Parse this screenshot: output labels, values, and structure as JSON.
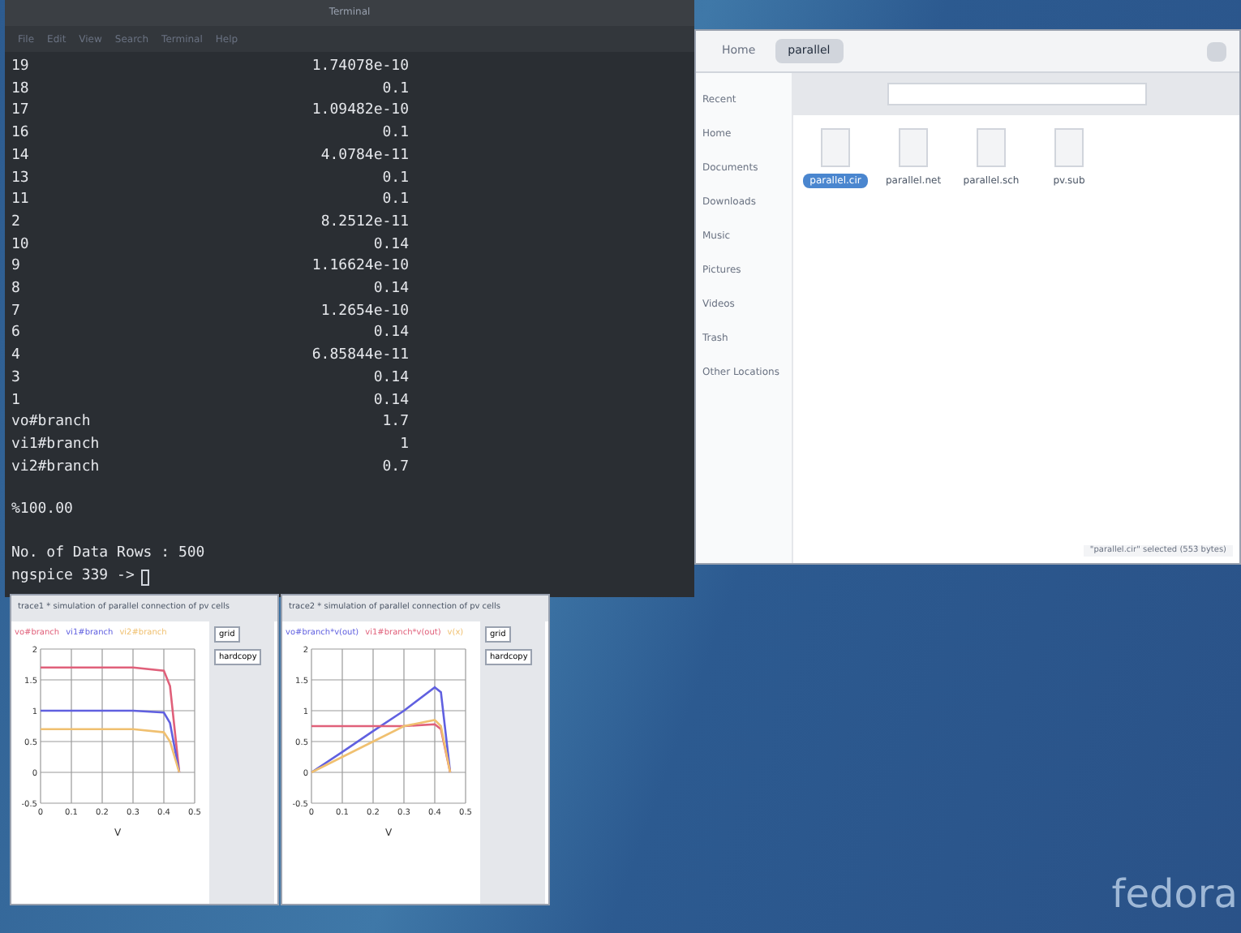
{
  "terminal": {
    "title": "Terminal",
    "menu": [
      "File",
      "Edit",
      "View",
      "Search",
      "Terminal",
      "Help"
    ],
    "rows": [
      {
        "name": "19",
        "value": "1.74078e-10"
      },
      {
        "name": "18",
        "value": "0.1"
      },
      {
        "name": "17",
        "value": "1.09482e-10"
      },
      {
        "name": "16",
        "value": "0.1"
      },
      {
        "name": "14",
        "value": "4.0784e-11"
      },
      {
        "name": "13",
        "value": "0.1"
      },
      {
        "name": "11",
        "value": "0.1"
      },
      {
        "name": "2",
        "value": "8.2512e-11"
      },
      {
        "name": "10",
        "value": "0.14"
      },
      {
        "name": "9",
        "value": "1.16624e-10"
      },
      {
        "name": "8",
        "value": "0.14"
      },
      {
        "name": "7",
        "value": "1.2654e-10"
      },
      {
        "name": "6",
        "value": "0.14"
      },
      {
        "name": "4",
        "value": "6.85844e-11"
      },
      {
        "name": "3",
        "value": "0.14"
      },
      {
        "name": "1",
        "value": "0.14"
      },
      {
        "name": "vo#branch",
        "value": "1.7"
      },
      {
        "name": "vi1#branch",
        "value": "1"
      },
      {
        "name": "vi2#branch",
        "value": "0.7"
      }
    ],
    "progress": "%100.00",
    "summary": "No. of Data Rows : 500",
    "prompt": "ngspice 339 ->"
  },
  "files": {
    "path": [
      {
        "label": "Home",
        "selected": false
      },
      {
        "label": "parallel",
        "selected": true
      }
    ],
    "sidebar": [
      "Recent",
      "Home",
      "Documents",
      "Downloads",
      "Music",
      "Pictures",
      "Videos",
      "Trash",
      "Other Locations"
    ],
    "items": [
      {
        "name": "parallel.cir",
        "selected": true
      },
      {
        "name": "parallel.net",
        "selected": false
      },
      {
        "name": "parallel.sch",
        "selected": false
      },
      {
        "name": "pv.sub",
        "selected": false
      }
    ],
    "status": "\"parallel.cir\" selected (553 bytes)"
  },
  "plots": [
    {
      "title": "trace1 * simulation of parallel connection of pv cells",
      "buttons": [
        "grid",
        "hardcopy"
      ],
      "chart_data": {
        "type": "line",
        "grid": true,
        "xlabel": "V",
        "x": [
          0,
          0.1,
          0.2,
          0.3,
          0.4,
          0.42,
          0.45
        ],
        "xlim": [
          0,
          0.5
        ],
        "ylim": [
          -0.5,
          2
        ],
        "xticks": [
          0,
          0.1,
          0.2,
          0.3,
          0.4,
          0.5
        ],
        "yticks": [
          -0.5,
          0,
          0.5,
          1,
          1.5,
          2
        ],
        "series": [
          {
            "name": "vo#branch",
            "color": "#e0607a",
            "values": [
              1.7,
              1.7,
              1.7,
              1.7,
              1.65,
              1.4,
              0
            ]
          },
          {
            "name": "vi1#branch",
            "color": "#6060e0",
            "values": [
              1,
              1,
              1,
              1,
              0.97,
              0.8,
              0
            ]
          },
          {
            "name": "vi2#branch",
            "color": "#f0c070",
            "values": [
              0.7,
              0.7,
              0.7,
              0.7,
              0.65,
              0.5,
              0
            ]
          }
        ]
      }
    },
    {
      "title": "trace2 * simulation of parallel connection of pv cells",
      "buttons": [
        "grid",
        "hardcopy"
      ],
      "chart_data": {
        "type": "line",
        "grid": true,
        "xlabel": "V",
        "x": [
          0,
          0.1,
          0.2,
          0.3,
          0.4,
          0.42,
          0.45
        ],
        "xlim": [
          0,
          0.5
        ],
        "ylim": [
          -0.5,
          2
        ],
        "xticks": [
          0,
          0.1,
          0.2,
          0.3,
          0.4,
          0.5
        ],
        "yticks": [
          -0.5,
          0,
          0.5,
          1,
          1.5,
          2
        ],
        "series": [
          {
            "name": "vo#branch*v(out)",
            "color": "#6060e0",
            "values": [
              0,
              0.33,
              0.67,
              1,
              1.38,
              1.3,
              0
            ]
          },
          {
            "name": "vi1#branch*v(out)",
            "color": "#e0607a",
            "values": [
              0.75,
              0.75,
              0.75,
              0.75,
              0.78,
              0.7,
              0
            ]
          },
          {
            "name": "v(x)",
            "color": "#f0c070",
            "values": [
              0,
              0.25,
              0.5,
              0.75,
              0.85,
              0.75,
              0
            ]
          }
        ]
      }
    }
  ],
  "desktop": {
    "logo": "fedora"
  }
}
